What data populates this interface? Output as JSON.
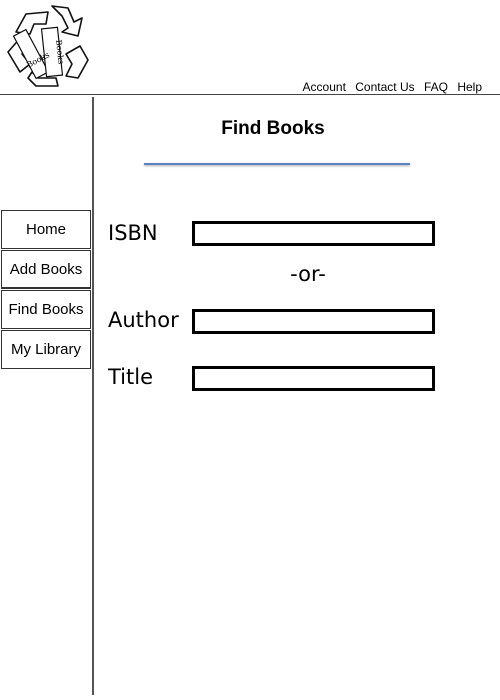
{
  "header": {
    "logo": {
      "icon": "recycle-books-logo-icon",
      "book_text_left": "Books",
      "book_text_right": "Books"
    },
    "links": [
      "Account",
      "Contact Us",
      "FAQ",
      "Help"
    ]
  },
  "sidebar": {
    "items": [
      {
        "label": "Home"
      },
      {
        "label": "Add Books"
      },
      {
        "label": "Find Books"
      },
      {
        "label": "My Library"
      }
    ]
  },
  "main": {
    "title": "Find Books",
    "divider_text": "-or-",
    "fields": {
      "isbn": {
        "label": "ISBN",
        "value": ""
      },
      "author": {
        "label": "Author",
        "value": ""
      },
      "title": {
        "label": "Title",
        "value": ""
      }
    }
  },
  "colors": {
    "title_underline": "#5b82c2",
    "border": "#000000"
  }
}
